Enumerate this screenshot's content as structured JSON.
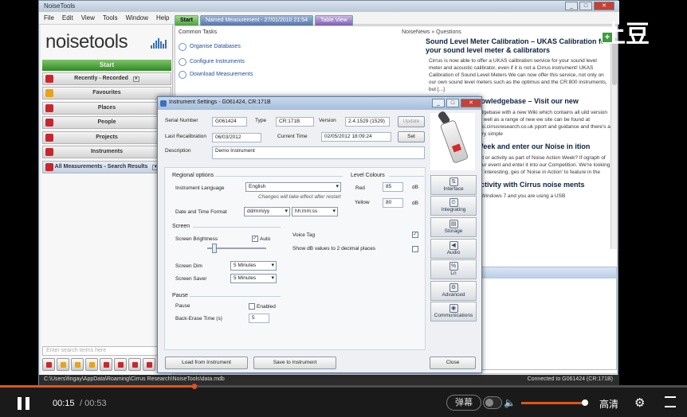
{
  "app": {
    "title": "NoiseTools",
    "menu": [
      "File",
      "Edit",
      "View",
      "Tools",
      "Window",
      "Help"
    ],
    "window_controls": [
      "_",
      "□",
      "✕"
    ]
  },
  "sidebar": {
    "logo": "noisetools",
    "start_label": "Start",
    "items": [
      {
        "label": "Recently - Recorded",
        "icon": "pin-icon",
        "color": "#c6282d"
      },
      {
        "label": "Favourites",
        "icon": "star-icon",
        "color": "#e8a317"
      },
      {
        "label": "Places",
        "icon": "home-icon",
        "color": "#c6282d"
      },
      {
        "label": "People",
        "icon": "person-icon",
        "color": "#c6282d"
      },
      {
        "label": "Projects",
        "icon": "document-icon",
        "color": "#c6282d"
      },
      {
        "label": "Instruments",
        "icon": "meter-icon",
        "color": "#c6282d"
      },
      {
        "label": "All Measurements - Search Results",
        "icon": "document-icon",
        "color": "#c6282d"
      }
    ],
    "search_placeholder": "Enter search terms here"
  },
  "tabs": [
    {
      "label": "Start"
    },
    {
      "label": "Named Measurement - 27/01/2010 21:54"
    },
    {
      "label": "Table View"
    }
  ],
  "common_tasks": {
    "heading": "Common Tasks",
    "items": [
      "Organise Databases",
      "Configure Instruments",
      "Download Measurements"
    ]
  },
  "news": {
    "heading": "NoiseNews » Questions",
    "articles": [
      {
        "title": "Sound Level Meter Calibration – UKAS Calibration for your sound level meter & calibrators",
        "body": "Cirrus is now able to offer a UKAS calibration service for your sound level meter and acoustic calibrator, even if it is not a Cirrus instrument! UKAS Calibration of Sound Level Meters We can now offer this service, not only on our own sound level meters such as the optimus and the CR:800 instruments, but [...]"
      },
      {
        "title": "nowledgebase – Visit our new",
        "body": "ledgebase with a new Wiki which contains all uild version as well as a range of new ew site can be found at wiki.cirrusresearch.co.uk pport and guidance and there's a very simple"
      },
      {
        "title": "Week and enter our Noise in ition",
        "body": "ent or activity as part of Noise Action Week? If ograph of your event and enter it into our Competition. We're looking for interesting, ges of 'Noise in Action' to feature in the"
      },
      {
        "title": "ectivity with Cirrus noise ments",
        "body": "o Windows 7 and you are using a USB"
      }
    ]
  },
  "dialog": {
    "title": "Instrument Settings - G061424, CR:171B",
    "serial_label": "Serial Number",
    "serial_value": "G061424",
    "type_label": "Type",
    "type_value": "CR:171B",
    "version_label": "Version",
    "version_value": "2.4.1529  (1529)",
    "update_label": "Update",
    "last_recal_label": "Last Recalibration",
    "last_recal_value": "06/03/2012",
    "current_time_label": "Current Time",
    "current_time_value": "02/05/2012 18:09:24",
    "set_label": "Set",
    "description_label": "Description",
    "description_value": "Demo Instrument",
    "regional_heading": "Regional options",
    "language_label": "Instrument Language",
    "language_value": "English",
    "language_note": "Changes will take effect after restart",
    "datetime_label": "Date and Time Format",
    "date_format": "dd/mm/yy",
    "time_format": "hh:mm:ss",
    "level_heading": "Level Colours",
    "red_label": "Red",
    "red_value": "85",
    "yellow_label": "Yellow",
    "yellow_value": "80",
    "unit": "dB",
    "screen_heading": "Screen",
    "brightness_label": "Screen Brightness",
    "auto_label": "Auto",
    "auto_checked": true,
    "voice_tag_label": "Voice Tag",
    "voice_tag_checked": true,
    "decimal_label": "Show dB values to 2 decimal places",
    "decimal_checked": false,
    "dim_label": "Screen Dim",
    "dim_value": "5 Minutes",
    "saver_label": "Screen Saver",
    "saver_value": "5 Minutes",
    "pause_heading": "Pause",
    "pause_label": "Pause",
    "enabled_label": "Enabled",
    "pause_enabled": false,
    "back_erase_label": "Back-Erase Time (s)",
    "back_erase_value": "5",
    "load_button": "Load from Instrument",
    "save_button": "Save to Instrument",
    "close_button": "Close",
    "side_buttons": [
      {
        "label": "Interface",
        "icon": "interface-icon",
        "glyph": "⇅"
      },
      {
        "label": "Integrating",
        "icon": "integrating-icon",
        "glyph": "⏲"
      },
      {
        "label": "Storage",
        "icon": "storage-icon",
        "glyph": "▤"
      },
      {
        "label": "Audio",
        "icon": "speaker-icon",
        "glyph": "◀"
      },
      {
        "label": "Ln",
        "icon": "percent-icon",
        "glyph": "%"
      },
      {
        "label": "Advanced",
        "icon": "gear-icon",
        "glyph": "⚙"
      },
      {
        "label": "Communications",
        "icon": "globe-icon",
        "glyph": "◉"
      }
    ]
  },
  "statusbar": {
    "path": "C:\\Users\\fingay\\AppData\\Roaming\\Cirrus Research\\NoiseTools\\data.mdb",
    "connection": "Connected to G061424 (CR:171B)"
  },
  "watermark": {
    "text": "土豆",
    "badge": "+"
  },
  "player": {
    "current_time": "00:15",
    "total_time": "/ 00:53",
    "progress": 0.283,
    "danmu_label": "弹幕",
    "volume": 0.95,
    "quality_label": "高清",
    "accent_color": "#e0541e"
  }
}
